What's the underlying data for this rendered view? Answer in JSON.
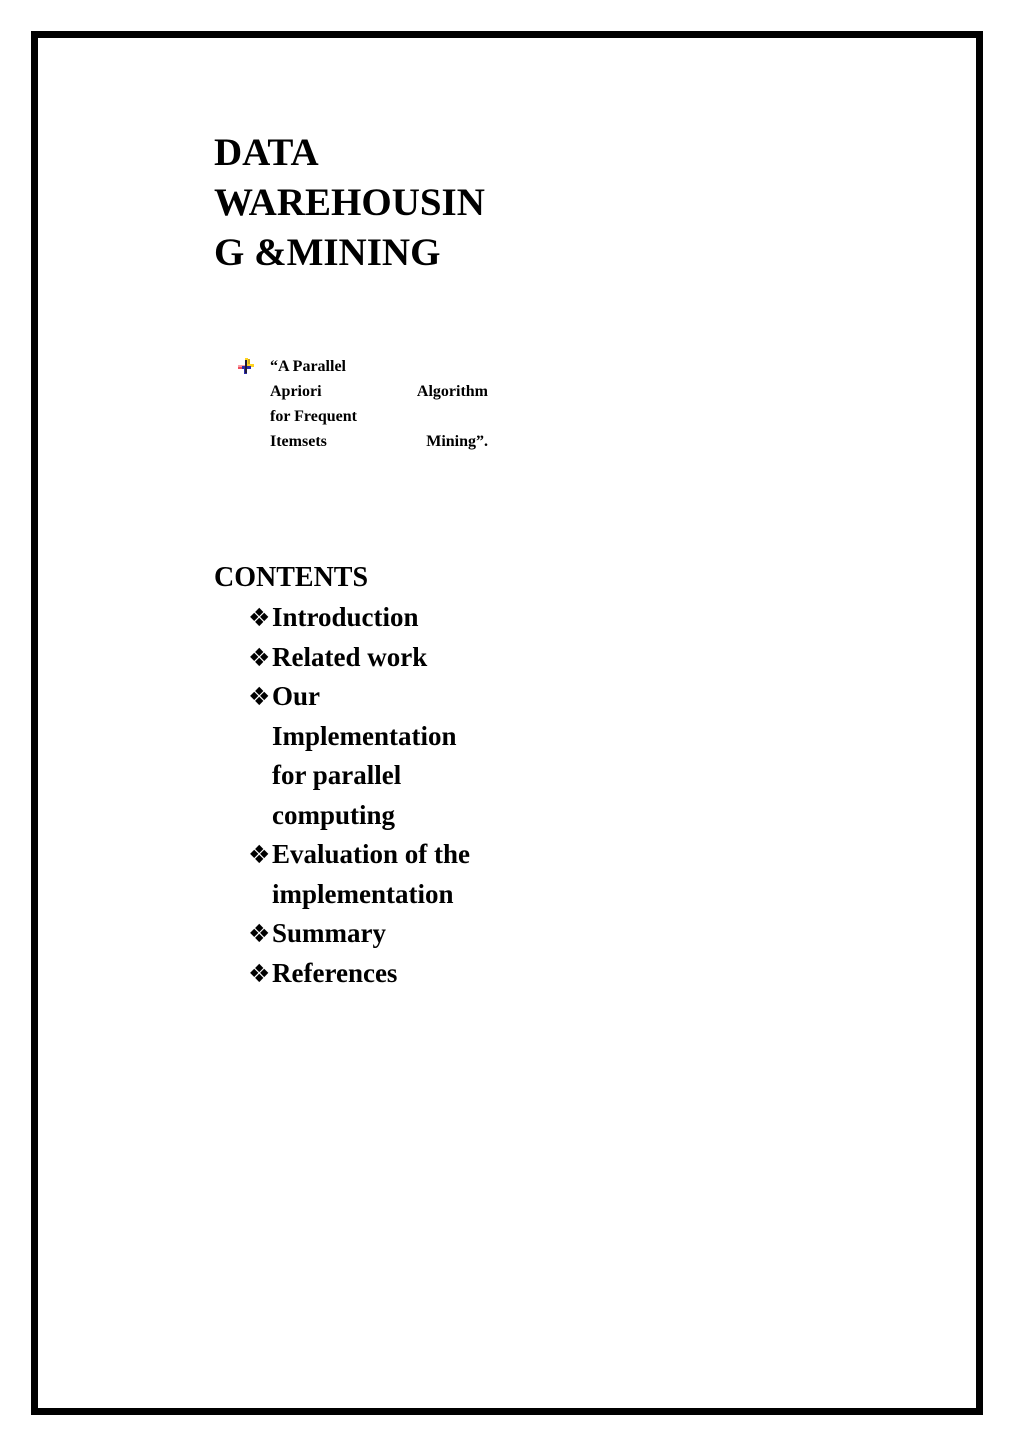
{
  "page": {
    "background_color": "#ffffff",
    "border_color": "#000000",
    "text_color": "#000000"
  },
  "title": {
    "text": "DATA WAREHOUSING &MINING"
  },
  "subtitle": {
    "bullet_icon": "pinwheel-bullet-icon",
    "icon_colors": {
      "yellow": "#ffd320",
      "blue": "#2a2aa8",
      "red": "#f04a5a",
      "dark": "#201a3a"
    },
    "line1": "“A Parallel",
    "line2": "Apriori  Algorithm",
    "line3": "for  Frequent",
    "line4": "Itemsets  Mining”."
  },
  "contents": {
    "heading": "CONTENTS",
    "bullet_glyph": "❖",
    "items": [
      {
        "label": "Introduction"
      },
      {
        "label": "Related work"
      },
      {
        "label": "Our Implementation for parallel computing"
      },
      {
        "label": "Evaluation of the implementation"
      },
      {
        "label": "Summary"
      },
      {
        "label": "References"
      }
    ]
  }
}
